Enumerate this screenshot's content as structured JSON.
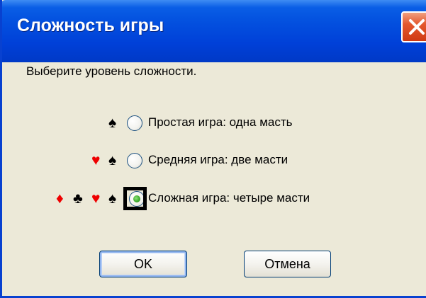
{
  "window": {
    "title": "Сложность игры",
    "close_icon": "close-icon"
  },
  "prompt": "Выберите уровень сложности.",
  "options": [
    {
      "label": "Простая игра: одна масть",
      "suits": [
        "♠"
      ],
      "selected": false
    },
    {
      "label": "Средняя игра: две масти",
      "suits": [
        "♥",
        "♠"
      ],
      "selected": false
    },
    {
      "label": "Сложная игра: четыре масти",
      "suits": [
        "♦",
        "♣",
        "♥",
        "♠"
      ],
      "selected": true
    }
  ],
  "buttons": {
    "ok_label": "OK",
    "cancel_label": "Отмена"
  },
  "colors": {
    "title_bar": "#0a5ee6",
    "window_bg": "#ece9d8",
    "close_button": "#e4582e",
    "red_suit": "#ee0000",
    "radio_selected": "#3aa82a"
  }
}
